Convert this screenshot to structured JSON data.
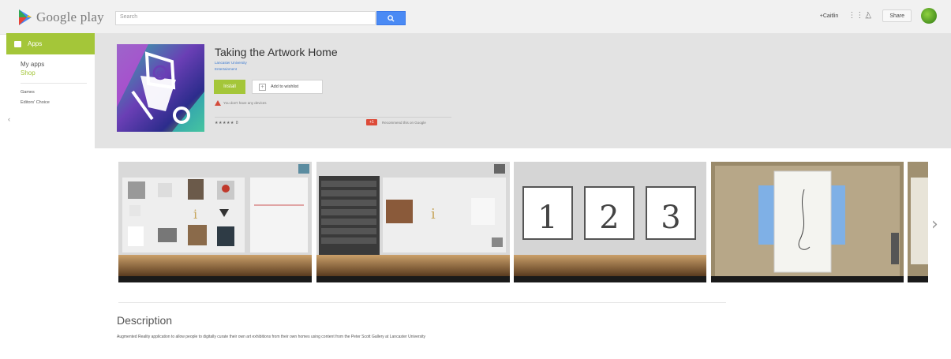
{
  "header": {
    "logo_text": "Google play",
    "search_placeholder": "Search",
    "user_name": "+Caitlin",
    "share_label": "Share"
  },
  "sidebar": {
    "active": "Apps",
    "items": [
      "My apps",
      "Shop"
    ],
    "sub_items": [
      "Games",
      "Editors' Choice"
    ]
  },
  "app": {
    "title": "Taking the Artwork Home",
    "developer": "Lancaster University",
    "category": "Entertainment",
    "install_label": "Install",
    "wishlist_label": "Add to wishlist",
    "warning": "You don't have any devices",
    "rating_stars": "★★★★★",
    "rating_count": "8",
    "gplus_label": "+1",
    "gplus_text": "Recommend this on Google"
  },
  "screenshots": [
    {
      "label": "Screenshot 1"
    },
    {
      "label": "Screenshot 2"
    },
    {
      "label": "Screenshot 3",
      "numbers": [
        "1",
        "2",
        "3"
      ]
    },
    {
      "label": "Screenshot 4"
    },
    {
      "label": "Screenshot 5"
    }
  ],
  "description": {
    "title": "Description",
    "body": "Augmented Reality application to allow people to digitally curate their own art exhibitions from their own homes using content from the Peter Scott Gallery at Lancaster University"
  },
  "colors": {
    "accent": "#a4c639",
    "search_button": "#4a8af4",
    "hero_bg": "#e3e3e3"
  }
}
